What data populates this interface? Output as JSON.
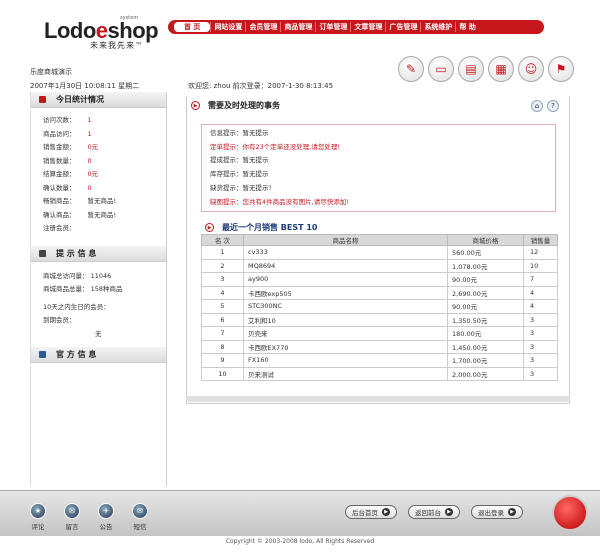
{
  "header": {
    "logo_prefix": "Lodo",
    "logo_mid": "e",
    "logo_suffix": "shop",
    "logo_system": "system",
    "logo_slogan": "未来我先来™",
    "nav": [
      "首 页",
      "网站设置",
      "会员管理",
      "商品管理",
      "订单管理",
      "文章管理",
      "广告管理",
      "系统维护",
      "帮 助"
    ]
  },
  "info": {
    "sitename": "乐度商城演示",
    "datetime": "2007年1月30日 10:08:11 星期二",
    "welcome": "欢迎您: zhou    前次登录：2007-1-30 8:13:45"
  },
  "sidebar": {
    "today_title": "今日统计情况",
    "today_rows": [
      {
        "label": "访问次数：",
        "value": "1"
      },
      {
        "label": "商品访问：",
        "value": "1"
      },
      {
        "label": "销售金额：",
        "value": "0元"
      },
      {
        "label": "销售数量：",
        "value": "0"
      },
      {
        "label": "结算金额：",
        "value": "0元"
      },
      {
        "label": "确认数量：",
        "value": "0"
      },
      {
        "label": "畅销商品：",
        "value": "暂无商品!"
      },
      {
        "label": "确认商品：",
        "value": "暂无商品!"
      },
      {
        "label": "注册会员：",
        "value": ""
      }
    ],
    "tips_title": "提 示 信 息",
    "tips_rows": [
      "商城总访问量： 11046",
      "商城商品总量： 158种商品",
      "10天之内生日的会员：",
      "到期会员："
    ],
    "tips_none": "无",
    "official_title": "官 方 信 息"
  },
  "main": {
    "title": "需要及时处理的事务",
    "notices": [
      {
        "text": "信息提示：暂无提示",
        "red": false
      },
      {
        "text": "定单提示：你有23个定单还没处理,请您处理!",
        "red": true
      },
      {
        "text": "提成提示：暂无提示",
        "red": false
      },
      {
        "text": "库存提示：暂无提示",
        "red": false
      },
      {
        "text": "缺货提示：暂无提示！",
        "red": false
      },
      {
        "text": "缺图提示：您共有4件商品没有图片,请尽快添加!",
        "red": true
      }
    ],
    "best_title": "最近一个月销售 BEST 10",
    "table": {
      "headers": [
        "名 次",
        "商品名称",
        "商城价格",
        "销售量"
      ],
      "rows": [
        [
          "1",
          "cv333",
          "560.00元",
          "12"
        ],
        [
          "2",
          "MQ8694",
          "1,078.00元",
          "10"
        ],
        [
          "3",
          "ay900",
          "90.00元",
          "7"
        ],
        [
          "4",
          "卡西欧exp505",
          "2,690.00元",
          "4"
        ],
        [
          "5",
          "STC300NC",
          "90.00元",
          "4"
        ],
        [
          "6",
          "艾利和10",
          "1,350.50元",
          "3"
        ],
        [
          "7",
          "贝壳来",
          "180.00元",
          "3"
        ],
        [
          "8",
          "卡西欧EX770",
          "1,450.00元",
          "3"
        ],
        [
          "9",
          "FX160",
          "1,700.00元",
          "3"
        ],
        [
          "10",
          "贝来测试",
          "2,000.00元",
          "3"
        ]
      ]
    }
  },
  "footer": {
    "buttons": [
      "评论",
      "留言",
      "公告",
      "短信"
    ],
    "pills": [
      "后台首页",
      "返回前台",
      "退出登录"
    ],
    "copyright": "Copyright © 2003-2008 lodo, All Rights Reserved"
  }
}
